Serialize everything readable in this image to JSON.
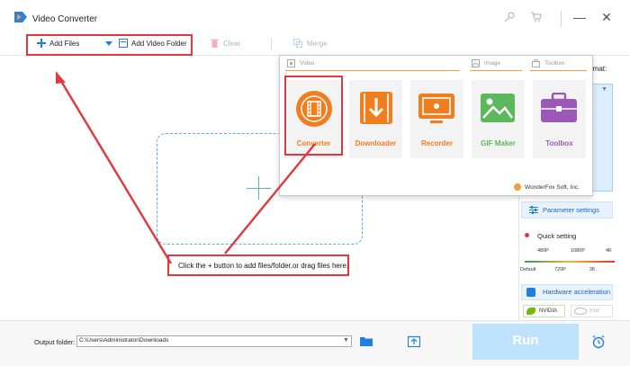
{
  "app": {
    "title": "Video Converter"
  },
  "window_controls": {
    "minimize": "—",
    "close": "✕"
  },
  "toolbar": {
    "add_files": "Add Files",
    "add_folder": "Add Video Folder",
    "clear": "Clear",
    "merge": "Merge"
  },
  "workarea": {
    "hint": "Click the + button to add files/folder,or drag files here."
  },
  "popup": {
    "tabs": {
      "video": "Video",
      "image": "Image",
      "toolbox": "Toolbox"
    },
    "tiles": [
      {
        "label": "Converter",
        "color": "#f07d1e"
      },
      {
        "label": "Downloader",
        "color": "#f07d1e"
      },
      {
        "label": "Recorder",
        "color": "#f07d1e"
      },
      {
        "label": "GIF Maker",
        "color": "#5cb85c"
      },
      {
        "label": "Toolbox",
        "color": "#9b59b6"
      }
    ],
    "footer": "WonderFox Soft, Inc."
  },
  "right_panel": {
    "format_label": "rmat:",
    "parameter_settings": "Parameter settings",
    "quick_setting": "Quick setting",
    "quality_top": [
      "480P",
      "1080P",
      "4K"
    ],
    "quality_bottom": [
      "Default",
      "720P",
      "2K"
    ],
    "hardware_acceleration": "Hardware acceleration",
    "nvidia": "NVIDIA",
    "intel": "Intel"
  },
  "bottom": {
    "output_label": "Output folder:",
    "output_path": "C:\\Users\\Administrator\\Downloads",
    "run": "Run"
  },
  "colors": {
    "accent": "#1f7fde",
    "highlight": "#e0383e",
    "orange": "#f07d1e"
  }
}
